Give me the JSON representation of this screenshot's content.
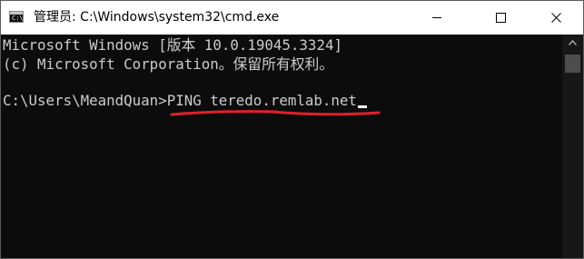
{
  "window": {
    "title": "管理员: C:\\Windows\\system32\\cmd.exe",
    "icon": "cmd-icon",
    "icon_prompt": "C:\\",
    "controls": {
      "minimize": "minimize-icon",
      "maximize": "maximize-icon",
      "close": "close-icon"
    }
  },
  "console": {
    "lines": [
      "Microsoft Windows [版本 10.0.19045.3324]",
      "(c) Microsoft Corporation。保留所有权利。"
    ],
    "prompt": "C:\\Users\\MeandQuan>",
    "command": "PING teredo.remlab.net"
  },
  "colors": {
    "console_bg": "#0c0c0c",
    "console_text": "#cccccc",
    "annotation": "#e0202a",
    "titlebar_bg": "#ffffff"
  }
}
